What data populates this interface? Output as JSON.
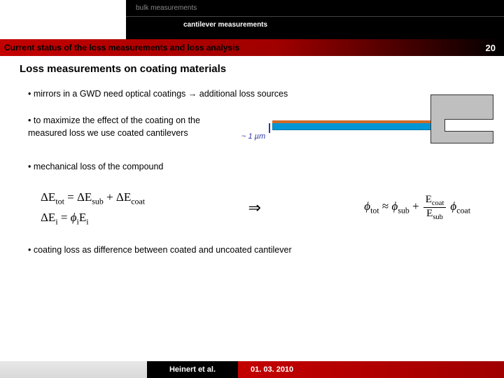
{
  "header": {
    "tabs": [
      {
        "label": "bulk measurements"
      },
      {
        "label": "cantilever measurements"
      }
    ]
  },
  "title": {
    "text": "Current status of the loss measurements and loss analysis",
    "page_number": "20"
  },
  "content": {
    "subtitle": "Loss measurements on coating materials",
    "bullets": [
      "• mirrors in a GWD need optical coatings → additional loss sources",
      "• to maximize the effect of the coating on the measured loss we use coated cantilevers",
      "• mechanical loss of the compound",
      "• coating loss as difference between coated and uncoated cantilever"
    ]
  },
  "diagram": {
    "thickness_label": "~ 1 µm"
  },
  "formulas": {
    "line1": "ΔEtot = ΔEsub + ΔEcoat",
    "line2": "ΔEi = ϕi Ei",
    "arrow": "⇒",
    "rhs_prefix": "ϕtot ≈ ϕsub +",
    "frac_num": "Ecoat",
    "frac_den": "Esub",
    "rhs_suffix": "ϕcoat"
  },
  "footer": {
    "author": "Heinert et al.",
    "date": "01. 03. 2010"
  }
}
